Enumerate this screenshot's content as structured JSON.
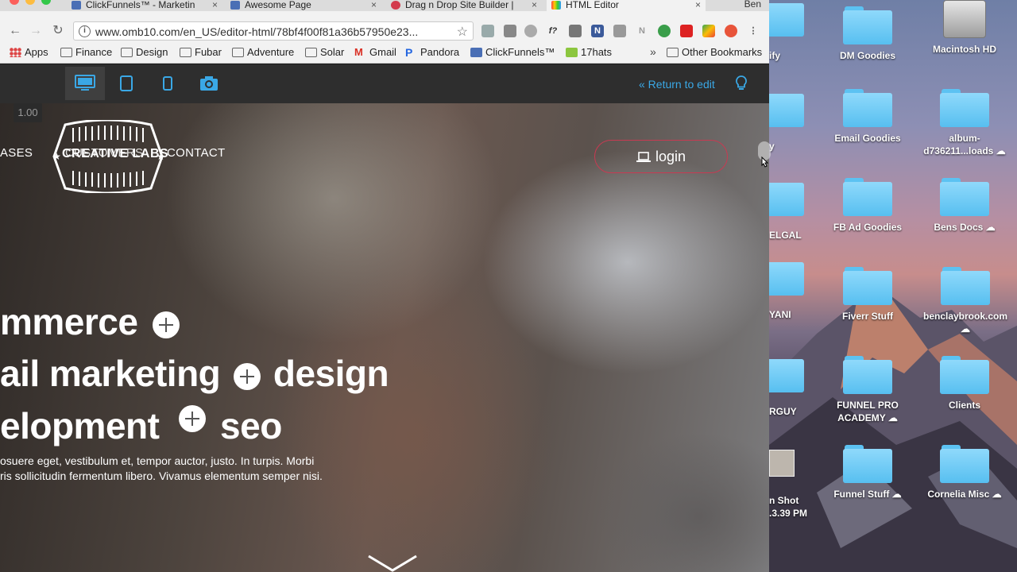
{
  "browser": {
    "tabs": [
      {
        "title": "ClickFunnels™ - Marketin"
      },
      {
        "title": "Awesome Page"
      },
      {
        "title": "Drag n Drop Site Builder |"
      },
      {
        "title": "HTML Editor"
      }
    ],
    "profile_name": "Ben",
    "url": "www.omb10.com/en_US/editor-html/78bf4f00f81a36b57950e23...",
    "bookmarks": [
      {
        "label": "Apps",
        "icon": "apps-grid-icon"
      },
      {
        "label": "Finance",
        "icon": "folder-icon"
      },
      {
        "label": "Design",
        "icon": "folder-icon"
      },
      {
        "label": "Fubar",
        "icon": "folder-icon"
      },
      {
        "label": "Adventure",
        "icon": "folder-icon"
      },
      {
        "label": "Solar",
        "icon": "folder-icon"
      },
      {
        "label": "Gmail",
        "icon": "gmail-icon"
      },
      {
        "label": "Pandora",
        "icon": "pandora-icon"
      },
      {
        "label": "ClickFunnels™",
        "icon": "clickfunnels-icon"
      },
      {
        "label": "17hats",
        "icon": "17hats-icon"
      }
    ],
    "bookmarks_more": "»",
    "other_bookmarks": "Other Bookmarks"
  },
  "editor": {
    "return_label": "« Return to edit",
    "zoom": "1.00"
  },
  "hero": {
    "nav": {
      "left_partial": "ASES",
      "overlap": "CUSTOMERS",
      "contact": "CONTACT"
    },
    "logo_text": "CREATIVE LABS",
    "login_label": "login",
    "line1": "mmerce",
    "line2a": "ail marketing",
    "line2b": "design",
    "line3a": "elopment",
    "line3b": "seo",
    "body1": "osuere eget, vestibulum et, tempor auctor, justo. In turpis. Morbi",
    "body2": "ris sollicitudin fermentum libero. Vivamus elementum semper nisi."
  },
  "desktop": {
    "partial_items": [
      {
        "label": "ify",
        "cloud": true
      },
      {
        "label": "y",
        "cloud": true
      },
      {
        "label": "ELGAL",
        "cloud": false
      },
      {
        "label": "YANI",
        "cloud": false
      },
      {
        "label": "RGUY",
        "cloud": false
      },
      {
        "label": "n Shot",
        "sub": ".3.39 PM",
        "cloud": false
      }
    ],
    "col1": [
      {
        "label": "DM Goodies"
      },
      {
        "label": "Email Goodies"
      },
      {
        "label": "FB Ad Goodies"
      },
      {
        "label": "Fiverr Stuff"
      },
      {
        "label": "FUNNEL PRO ACADEMY ☁"
      },
      {
        "label": "Funnel Stuff ☁"
      }
    ],
    "col2": [
      {
        "label": "Macintosh HD"
      },
      {
        "label": "album-d736211...loads ☁"
      },
      {
        "label": "Bens Docs ☁"
      },
      {
        "label": "benclaybrook.com ☁"
      },
      {
        "label": "Clients"
      },
      {
        "label": "Cornelia Misc ☁"
      }
    ]
  },
  "colors": {
    "accent": "#3aa8e6",
    "login_border": "#c83a52",
    "folder": "#6ccbf7"
  }
}
